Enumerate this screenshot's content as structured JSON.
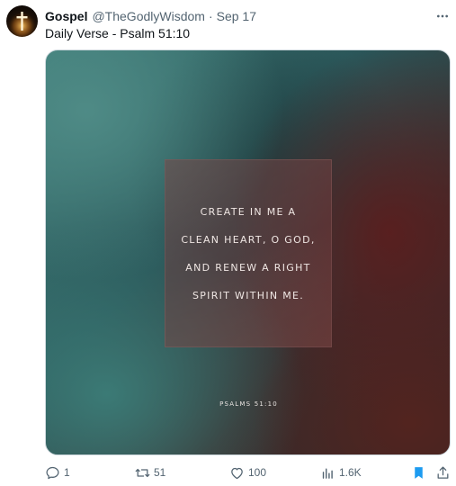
{
  "author": {
    "name": "Gospel",
    "handle": "@TheGodlyWisdom",
    "separator": "·",
    "date": "Sep 17"
  },
  "tweet": {
    "text": "Daily Verse - Psalm 51:10"
  },
  "media": {
    "quote_lines": [
      "CREATE IN ME A",
      "CLEAN HEART, O GOD,",
      "AND RENEW A RIGHT",
      "SPIRIT WITHIN ME."
    ],
    "reference": "PSALMS 51:10"
  },
  "actions": {
    "reply": {
      "icon": "reply-icon",
      "count": "1"
    },
    "retweet": {
      "icon": "retweet-icon",
      "count": "51"
    },
    "like": {
      "icon": "heart-icon",
      "count": "100"
    },
    "views": {
      "icon": "views-icon",
      "count": "1.6K"
    },
    "bookmark": {
      "icon": "bookmark-icon",
      "active": true
    },
    "share": {
      "icon": "share-icon"
    }
  },
  "colors": {
    "text_primary": "#0f1419",
    "text_secondary": "#536471",
    "bookmark_active": "#1d9bf0"
  }
}
